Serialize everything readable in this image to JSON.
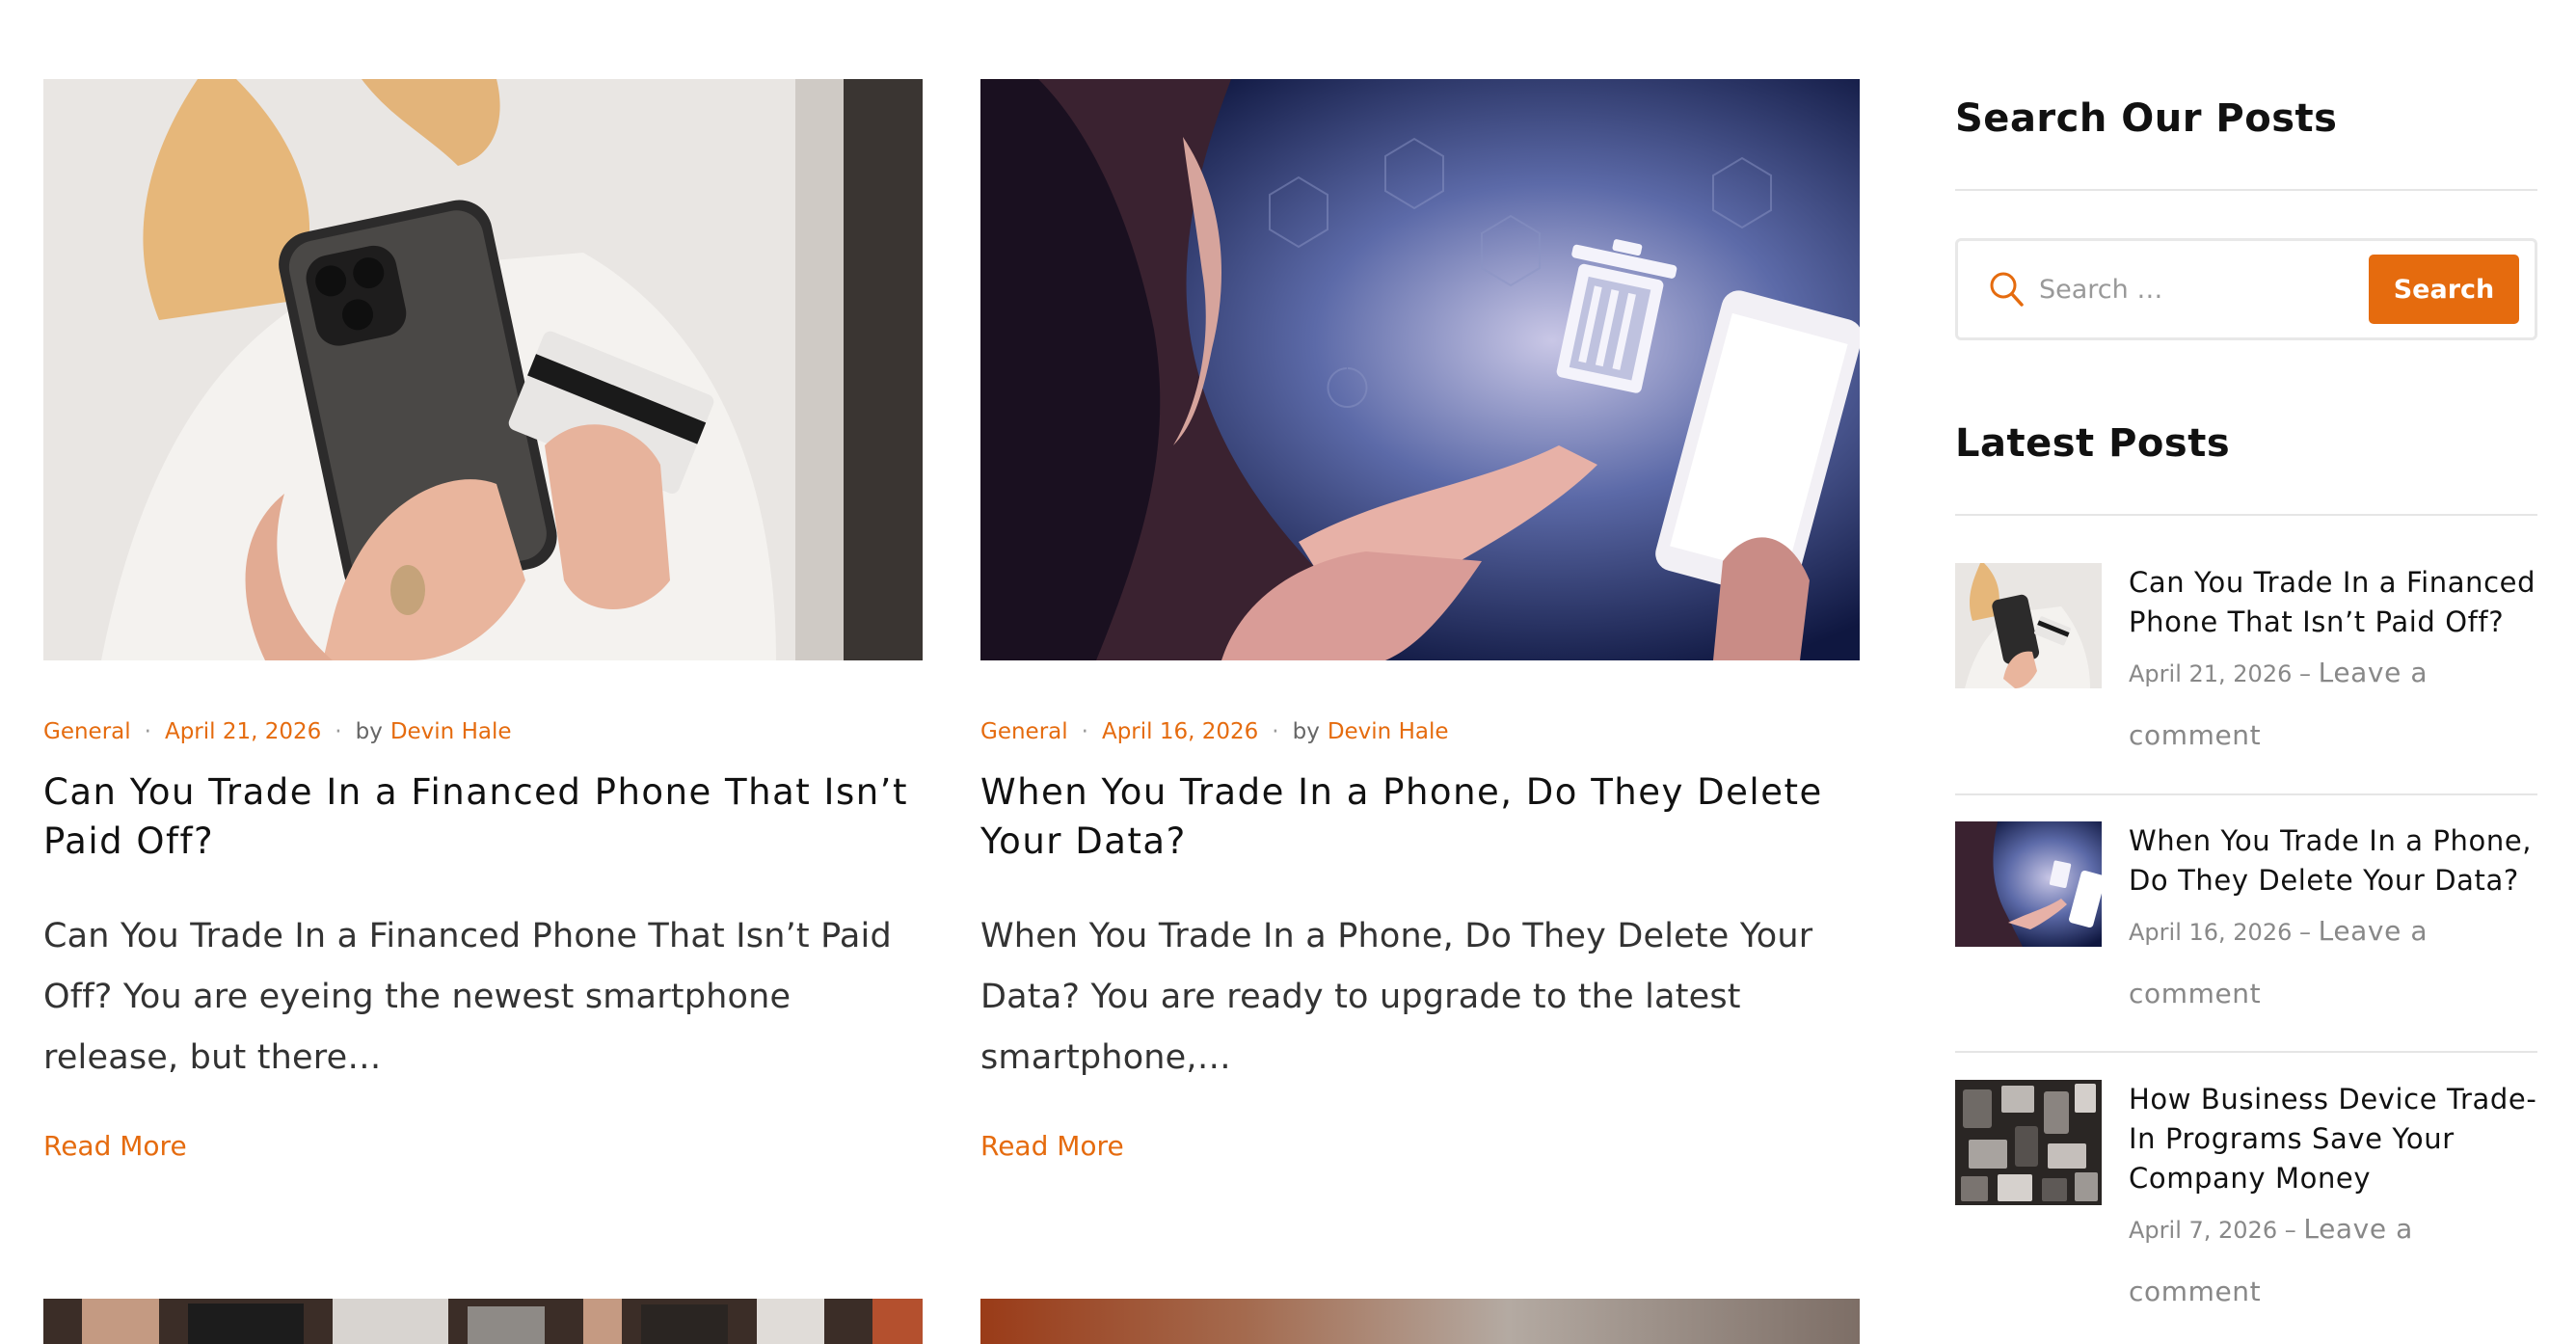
{
  "posts": [
    {
      "category": "General",
      "date": "April 21, 2026",
      "by": "by",
      "author": "Devin Hale",
      "title": "Can You Trade In a Financed Phone That Isn’t Paid Off?",
      "excerpt": "Can You Trade In a Financed Phone That Isn’t Paid Off? You are eyeing the newest smartphone release, but there…",
      "read_more": "Read More"
    },
    {
      "category": "General",
      "date": "April 16, 2026",
      "by": "by",
      "author": "Devin Hale",
      "title": "When You Trade In a Phone, Do They Delete Your Data?",
      "excerpt": "When You Trade In a Phone, Do They Delete Your Data? You are ready to upgrade to the latest smartphone,…",
      "read_more": "Read More"
    }
  ],
  "sidebar": {
    "search_title": "Search Our Posts",
    "search_placeholder": "Search …",
    "search_button": "Search",
    "latest_title": "Latest Posts",
    "latest": [
      {
        "title": "Can You Trade In a Financed Phone That Isn’t Paid Off?",
        "date": "April 21, 2026",
        "sep": " – ",
        "comment": "Leave a comment"
      },
      {
        "title": "When You Trade In a Phone, Do They Delete Your Data?",
        "date": "April 16, 2026",
        "sep": " – ",
        "comment": "Leave a comment"
      },
      {
        "title": "How Business Device Trade-In Programs Save Your Company Money",
        "date": "April 7, 2026",
        "sep": " – ",
        "comment": "Leave a comment"
      }
    ]
  },
  "colors": {
    "accent": "#e56b0e",
    "text": "#111111",
    "muted": "#888888"
  }
}
